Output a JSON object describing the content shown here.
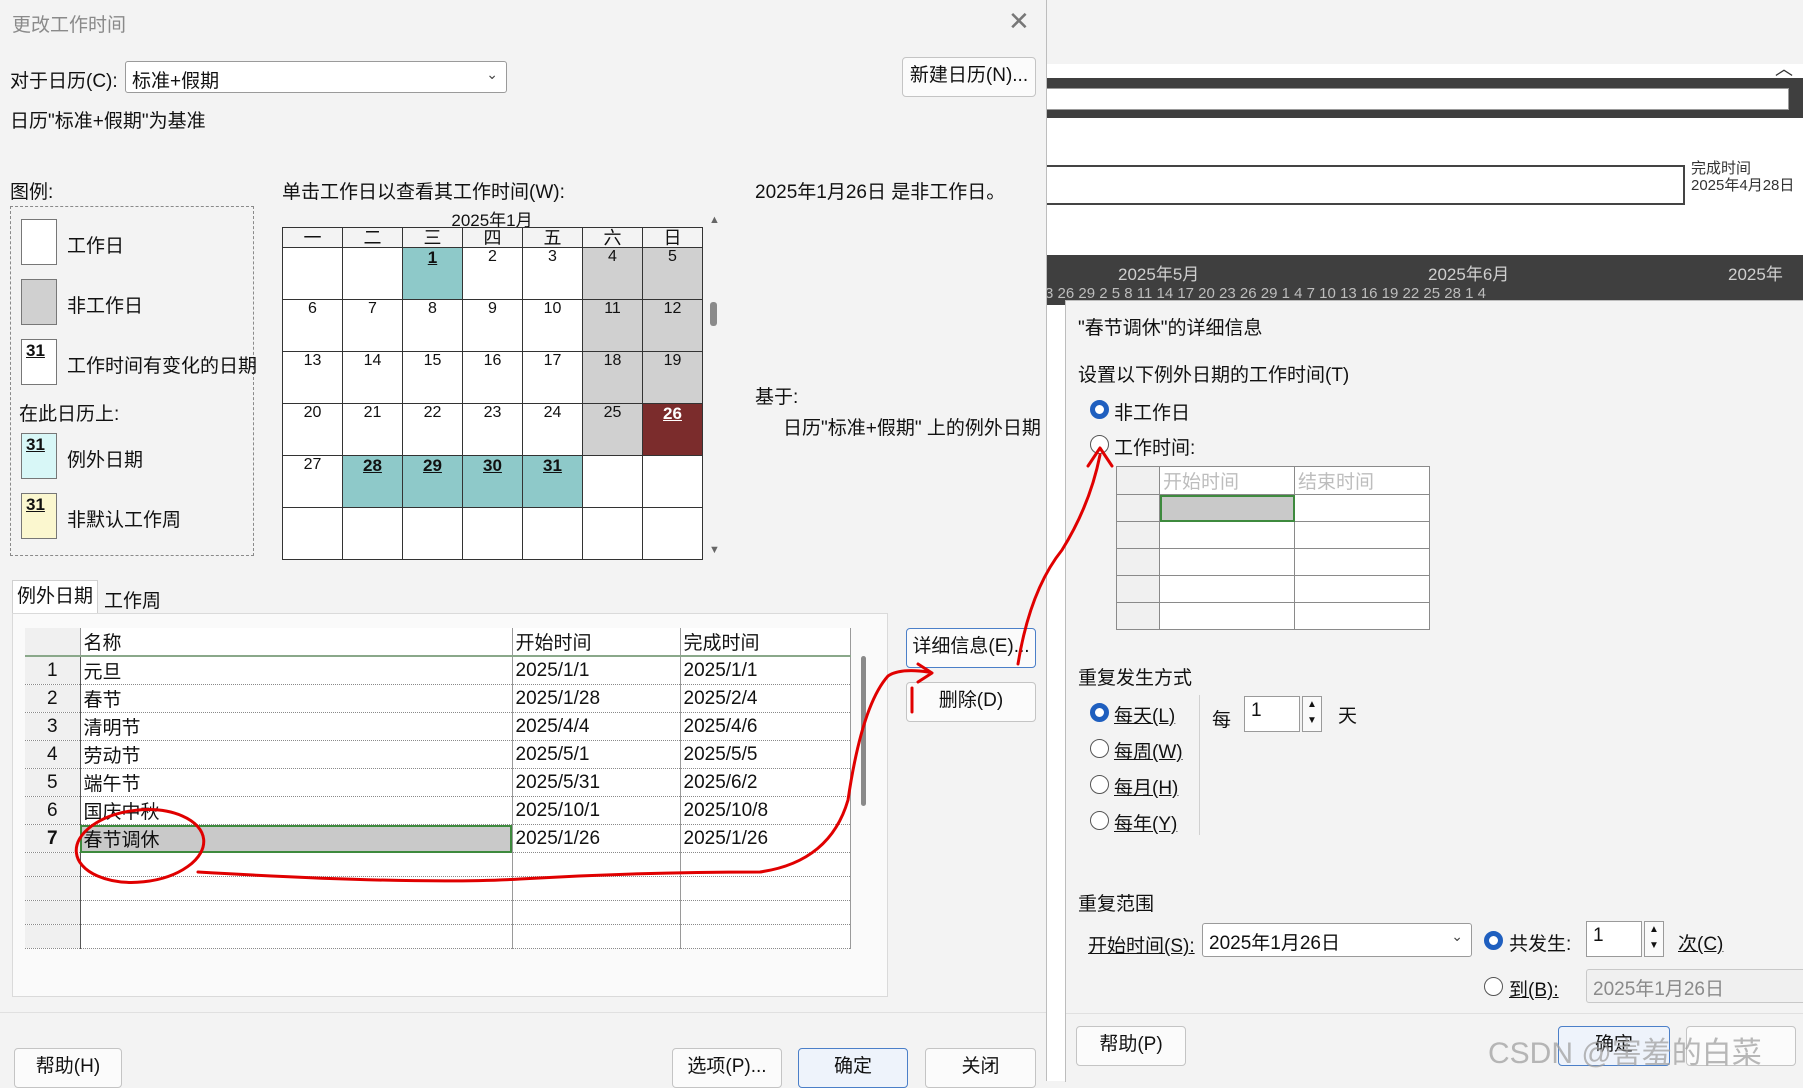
{
  "background_app": {
    "finish_label": "完成时间",
    "finish_date": "2025年4月28日",
    "months": [
      "2025年5月",
      "2025年6月",
      "2025年"
    ],
    "days_row": "3  26  29  2   5   8  11  14  17  20  23  26  29  1   4   7  10  13  16  19  22  25  28  1   4"
  },
  "main_dialog": {
    "title": "更改工作时间",
    "for_calendar_label": "对于日历(C):",
    "calendar_value": "标准+假期",
    "new_calendar_button": "新建日历(N)...",
    "base_text": "日历\"标准+假期\"为基准",
    "legend_title": "图例:",
    "legend": {
      "working_day": "工作日",
      "non_working_day": "非工作日",
      "changed_day": "工作时间有变化的日期",
      "on_this_calendar": "在此日历上:",
      "exception_day": "例外日期",
      "nondefault_week": "非默认工作周",
      "swatch_number": "31"
    },
    "calendar_instruction": "单击工作日以查看其工作时间(W):",
    "month_title": "2025年1月",
    "weekdays": [
      "一",
      "二",
      "三",
      "四",
      "五",
      "六",
      "日"
    ],
    "status_text": "2025年1月26日 是非工作日。",
    "based_on_label": "基于:",
    "based_on_text": "日历\"标准+假期\" 上的例外日期",
    "tabs": [
      "例外日期",
      "工作周"
    ],
    "grid_headers": [
      "名称",
      "开始时间",
      "完成时间"
    ],
    "rows": [
      {
        "n": "1",
        "name": "元旦",
        "start": "2025/1/1",
        "finish": "2025/1/1"
      },
      {
        "n": "2",
        "name": "春节",
        "start": "2025/1/28",
        "finish": "2025/2/4"
      },
      {
        "n": "3",
        "name": "清明节",
        "start": "2025/4/4",
        "finish": "2025/4/6"
      },
      {
        "n": "4",
        "name": "劳动节",
        "start": "2025/5/1",
        "finish": "2025/5/5"
      },
      {
        "n": "5",
        "name": "端午节",
        "start": "2025/5/31",
        "finish": "2025/6/2"
      },
      {
        "n": "6",
        "name": "国庆中秋",
        "start": "2025/10/1",
        "finish": "2025/10/8"
      },
      {
        "n": "7",
        "name": "春节调休",
        "start": "2025/1/26",
        "finish": "2025/1/26"
      }
    ],
    "details_button": "详细信息(E)...",
    "delete_button": "删除(D)",
    "help_button": "帮助(H)",
    "options_button": "选项(P)...",
    "ok_button": "确定",
    "close_button": "关闭"
  },
  "detail_dialog": {
    "title": "\"春节调休\"的详细信息",
    "set_time_label": "设置以下例外日期的工作时间(T)",
    "nonworking_option": "非工作日",
    "working_time_option": "工作时间:",
    "wt_headers": [
      "开始时间",
      "结束时间"
    ],
    "recurrence_title": "重复发生方式",
    "daily": "每天(L)",
    "weekly": "每周(W)",
    "monthly": "每月(H)",
    "yearly": "每年(Y)",
    "every_label": "每",
    "every_value": "1",
    "day_unit": "天",
    "range_title": "重复范围",
    "start_label": "开始时间(S):",
    "start_value": "2025年1月26日",
    "occurrences_label": "共发生:",
    "occurrences_value": "1",
    "occurrences_unit": "次(C)",
    "end_by_label": "到(B):",
    "end_by_value": "2025年1月26日",
    "help_button": "帮助(P)",
    "ok_button": "确定"
  },
  "watermark": "CSDN @害羞的白菜"
}
